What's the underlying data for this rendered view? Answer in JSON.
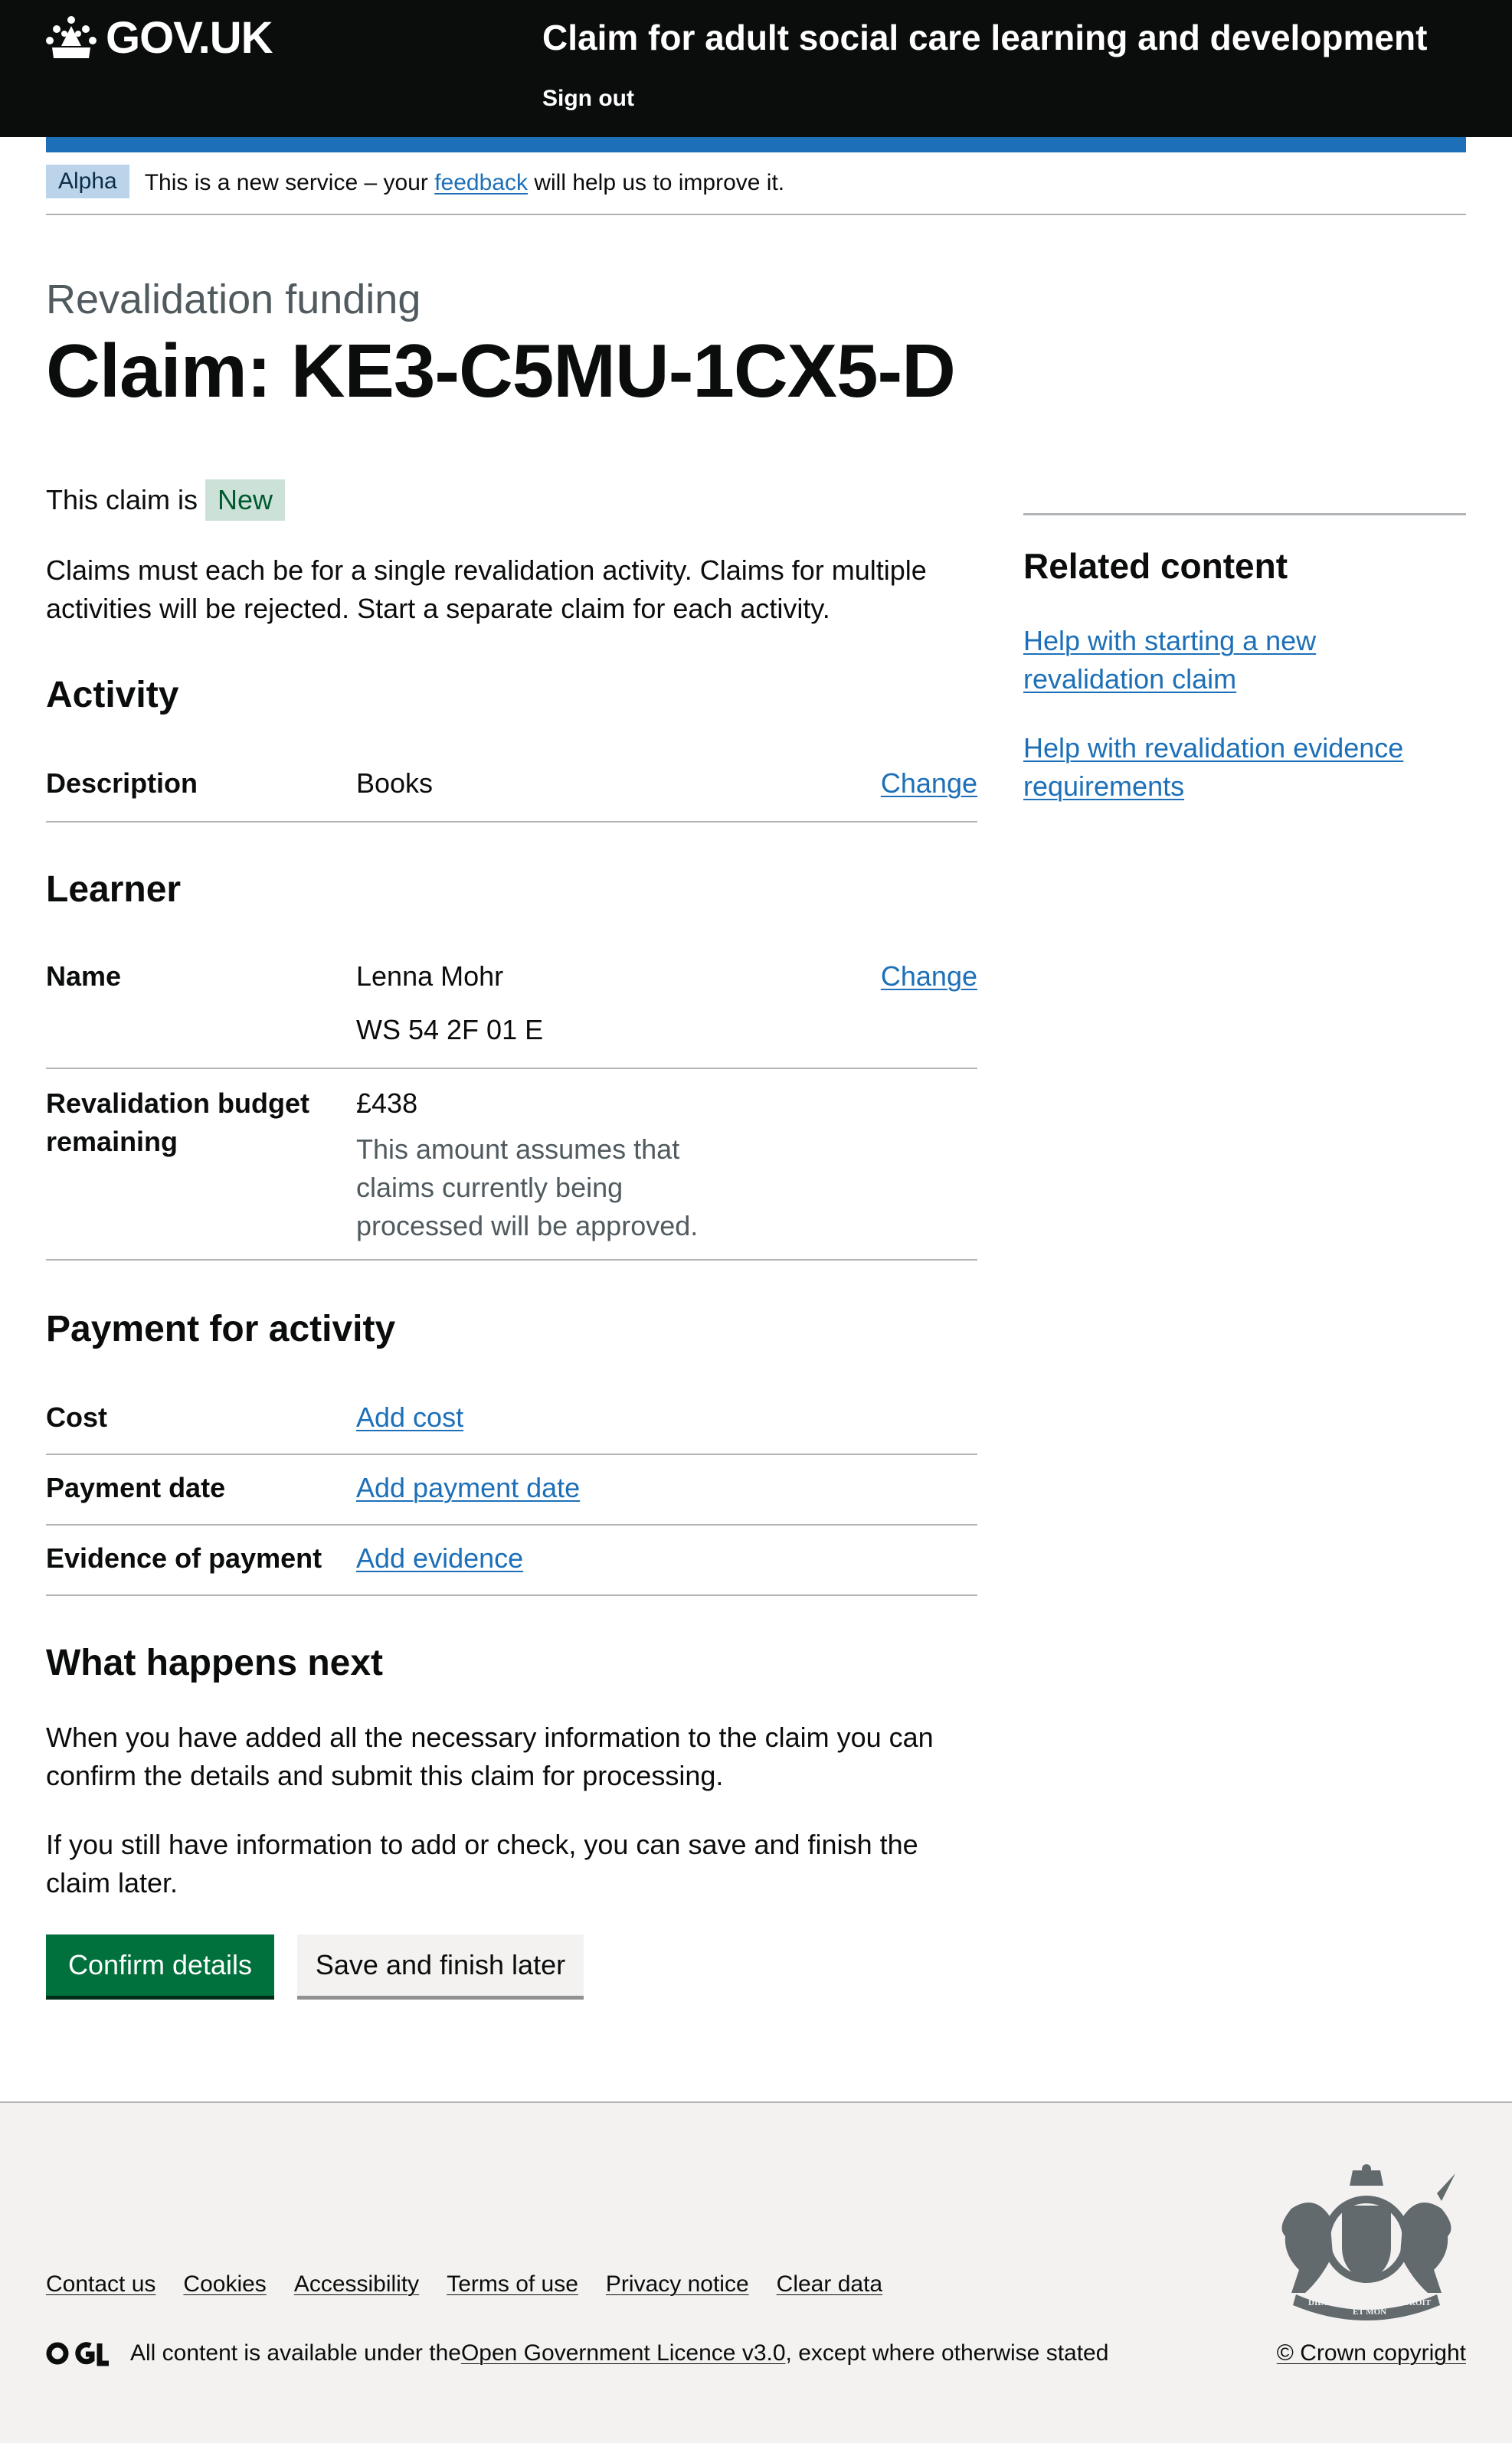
{
  "header": {
    "logo_text": "GOV.UK",
    "service_name": "Claim for adult social care learning and development",
    "sign_out": "Sign out",
    "colors": {
      "header_bg": "#0b0c0c",
      "blue_bar": "#1d70b8"
    }
  },
  "phase_banner": {
    "tag": "Alpha",
    "text_before": "This is a new service – your ",
    "link": "feedback",
    "text_after": " will help us to improve it."
  },
  "page": {
    "caption": "Revalidation funding",
    "title": "Claim: KE3-C5MU-1CX5-D",
    "status_prefix": "This claim is",
    "status_tag": "New",
    "intro": "Claims must each be for a single revalidation activity. Claims for multiple activities will be rejected. Start a separate claim for each activity."
  },
  "activity": {
    "heading": "Activity",
    "description_key": "Description",
    "description_value": "Books",
    "change": "Change"
  },
  "learner": {
    "heading": "Learner",
    "name_key": "Name",
    "name_value": "Lenna Mohr",
    "ni_number": "WS 54 2F 01 E",
    "change": "Change",
    "budget_key": "Revalidation budget remaining",
    "budget_value": "£438",
    "budget_hint": "This amount assumes that claims currently being processed will be approved."
  },
  "payment": {
    "heading": "Payment for activity",
    "cost_key": "Cost",
    "cost_action": "Add cost",
    "date_key": "Payment date",
    "date_action": "Add payment date",
    "evidence_key": "Evidence of payment",
    "evidence_action": "Add evidence"
  },
  "next": {
    "heading": "What happens next",
    "para1": "When you have added all the necessary information to the claim you can confirm the details and submit this claim for processing.",
    "para2": "If you still have information to add or check, you can save and finish the claim later.",
    "confirm_button": "Confirm details",
    "save_button": "Save and finish later"
  },
  "related": {
    "heading": "Related content",
    "links": [
      "Help with starting a new revalidation claim",
      "Help with revalidation evidence requirements"
    ]
  },
  "footer": {
    "links": [
      "Contact us",
      "Cookies",
      "Accessibility",
      "Terms of use",
      "Privacy notice",
      "Clear data"
    ],
    "licence_before": "All content is available under the ",
    "licence_link": "Open Government Licence v3.0",
    "licence_after": ", except where otherwise stated",
    "copyright": "© Crown copyright",
    "crest_motto_1": "DIEU",
    "crest_motto_2": "ET MON",
    "crest_motto_3": "DROIT"
  }
}
